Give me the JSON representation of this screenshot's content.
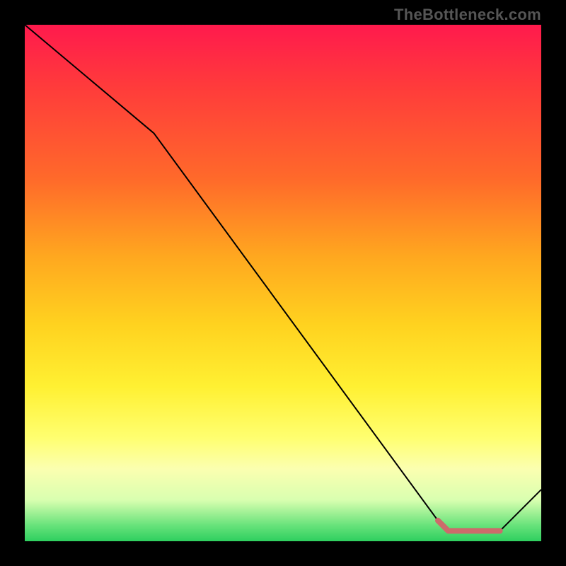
{
  "watermark": "TheBottleneck.com",
  "chart_data": {
    "type": "line",
    "title": "",
    "xlabel": "",
    "ylabel": "",
    "ylim": [
      0,
      100
    ],
    "xlim": [
      0,
      100
    ],
    "series": [
      {
        "name": "curve",
        "color": "#000000",
        "stroke_width": 2,
        "x": [
          0,
          25,
          80,
          82,
          91,
          92,
          100
        ],
        "values": [
          100,
          79,
          4,
          2,
          2,
          2,
          10
        ]
      },
      {
        "name": "highlight",
        "color": "#cc6b6b",
        "stroke_width": 8,
        "linecap": "round",
        "x": [
          80,
          82,
          91,
          92
        ],
        "values": [
          4,
          2,
          2,
          2
        ]
      }
    ],
    "gradient_stops": [
      {
        "pos": 0.0,
        "color": "#ff1a4d"
      },
      {
        "pos": 0.12,
        "color": "#ff3b3b"
      },
      {
        "pos": 0.3,
        "color": "#ff6a2a"
      },
      {
        "pos": 0.45,
        "color": "#ffa81f"
      },
      {
        "pos": 0.58,
        "color": "#ffd21f"
      },
      {
        "pos": 0.7,
        "color": "#fff032"
      },
      {
        "pos": 0.8,
        "color": "#ffff70"
      },
      {
        "pos": 0.86,
        "color": "#fbffb0"
      },
      {
        "pos": 0.92,
        "color": "#d9ffb0"
      },
      {
        "pos": 0.97,
        "color": "#66e27a"
      },
      {
        "pos": 1.0,
        "color": "#2ecf5f"
      }
    ]
  }
}
